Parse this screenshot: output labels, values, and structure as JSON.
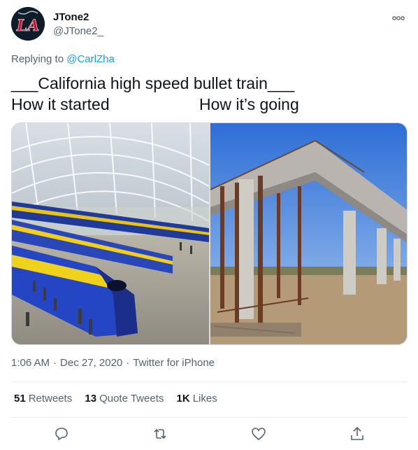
{
  "author": {
    "name": "JTone2",
    "handle": "@JTone2_",
    "avatar_icon": "la-angels-logo-icon",
    "avatar_text": "LA"
  },
  "reply": {
    "prefix": "Replying to",
    "target": "@CarlZha"
  },
  "tweet": {
    "line1": "___California high speed bullet train___",
    "line2_left": "How it started",
    "line2_right": "How it’s going"
  },
  "media": {
    "left_image": "train-station-rendering",
    "right_image": "unfinished-viaduct-photo"
  },
  "meta": {
    "time": "1:06 AM",
    "date": "Dec 27, 2020",
    "source": "Twitter for iPhone"
  },
  "stats": {
    "retweets_count": "51",
    "retweets_label": "Retweets",
    "quotes_count": "13",
    "quotes_label": "Quote Tweets",
    "likes_count": "1K",
    "likes_label": "Likes"
  },
  "actions": [
    "reply-icon",
    "retweet-icon",
    "like-icon",
    "share-icon"
  ],
  "colors": {
    "link": "#1d9bf0",
    "secondary_text": "#536471",
    "primary_text": "#0f1419",
    "avatar_bg": "#0d1b2a",
    "avatar_logo": "#c8102e"
  }
}
